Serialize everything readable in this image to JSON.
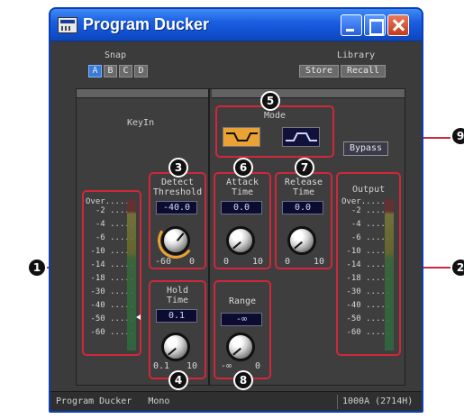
{
  "window": {
    "title": "Program Ducker"
  },
  "snap": {
    "label": "Snap",
    "buttons": [
      "A",
      "B",
      "C",
      "D"
    ],
    "active": "A"
  },
  "library": {
    "label": "Library",
    "store": "Store",
    "recall": "Recall"
  },
  "keyin": {
    "label": "KeyIn"
  },
  "mode": {
    "label": "Mode"
  },
  "bypass": {
    "label": "Bypass"
  },
  "meter_scale": [
    "Over",
    "-2",
    "-4",
    "-6",
    "-10",
    "-14",
    "-18",
    "-30",
    "-40",
    "-50",
    "-60"
  ],
  "output": {
    "label": "Output"
  },
  "detect": {
    "label_1": "Detect",
    "label_2": "Threshold",
    "value": "-40.0",
    "min": "-60",
    "max": "0"
  },
  "attack": {
    "label_1": "Attack",
    "label_2": "Time",
    "value": "0.0",
    "min": "0",
    "max": "10"
  },
  "release": {
    "label_1": "Release",
    "label_2": "Time",
    "value": "0.0",
    "min": "0",
    "max": "10"
  },
  "hold": {
    "label_1": "Hold",
    "label_2": "Time",
    "value": "0.1",
    "min": "0.1",
    "max": "10"
  },
  "range": {
    "label": "Range",
    "value": "-∞",
    "min": "-∞",
    "max": "0"
  },
  "callouts": [
    "1",
    "2",
    "3",
    "4",
    "5",
    "6",
    "7",
    "8",
    "9"
  ],
  "status": {
    "left": "Program Ducker   Mono",
    "right": "1000A (2714H)"
  }
}
